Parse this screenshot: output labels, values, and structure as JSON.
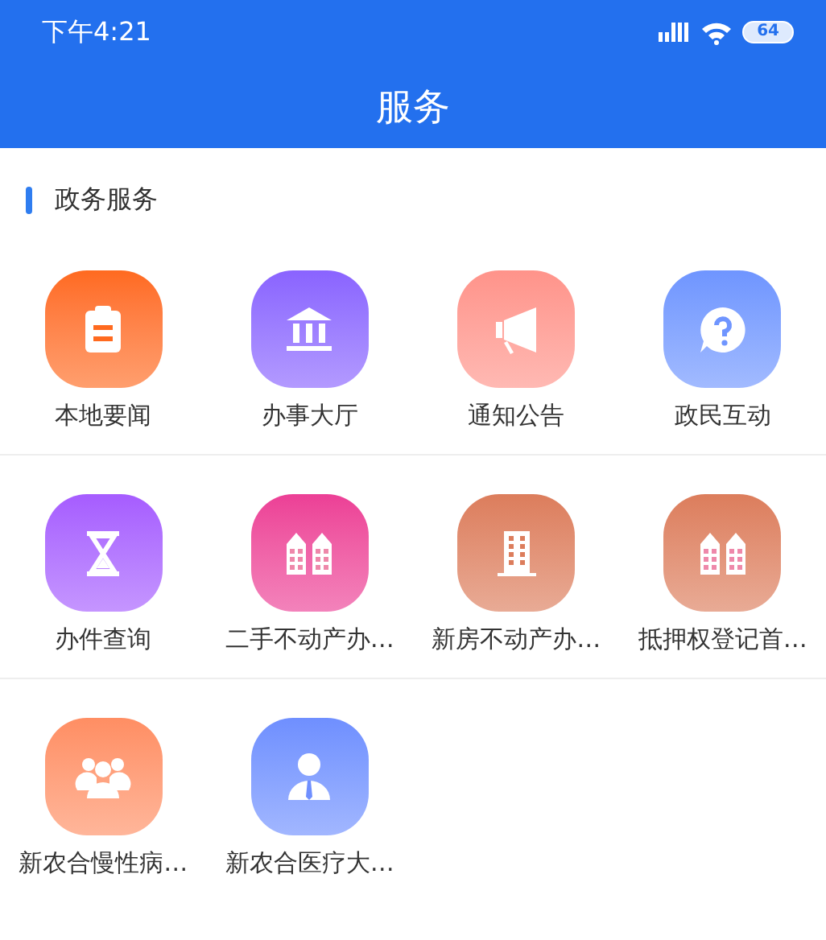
{
  "status_bar": {
    "time": "下午4:21",
    "battery": "64"
  },
  "header": {
    "title": "服务"
  },
  "section": {
    "title": "政务服务",
    "rows": [
      [
        {
          "label": "本地要闻",
          "kind": "clipboard",
          "color": "#ff6a1f"
        },
        {
          "label": "办事大厅",
          "kind": "bank",
          "color": "#8a63ff"
        },
        {
          "label": "通知公告",
          "kind": "megaphone",
          "color": "#ff938a"
        },
        {
          "label": "政民互动",
          "kind": "question",
          "color": "#6f95ff"
        }
      ],
      [
        {
          "label": "办件查询",
          "kind": "hourglass",
          "color": "#a65cff"
        },
        {
          "label": "二手不动产办…",
          "kind": "buildings",
          "color": "#ec3f96"
        },
        {
          "label": "新房不动产办…",
          "kind": "building",
          "color": "#dc7d5c"
        },
        {
          "label": "抵押权登记首…",
          "kind": "buildings",
          "color": "#dc7d5c"
        }
      ],
      [
        {
          "label": "新农合慢性病…",
          "kind": "group",
          "color": "#ff8e63"
        },
        {
          "label": "新农合医疗大…",
          "kind": "person",
          "color": "#6f8fff"
        }
      ]
    ]
  }
}
